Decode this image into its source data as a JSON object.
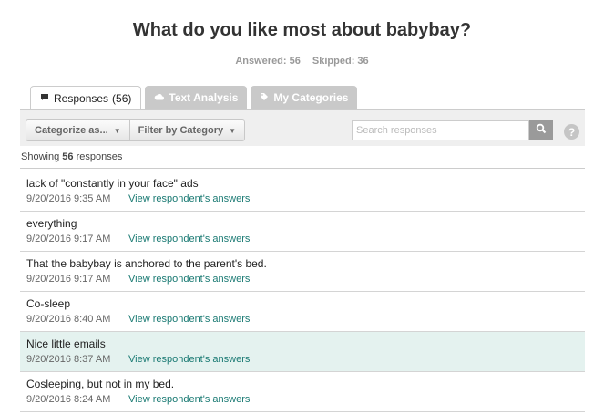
{
  "question": {
    "title": "What do you like most about babybay?",
    "answered": "Answered: 56",
    "skipped": "Skipped: 36"
  },
  "tabs": [
    {
      "label": "Responses",
      "count": "(56)",
      "icon": "speech-bubble-icon",
      "active": true
    },
    {
      "label": "Text Analysis",
      "icon": "cloud-icon",
      "active": false
    },
    {
      "label": "My Categories",
      "icon": "tag-icon",
      "active": false
    }
  ],
  "toolbar": {
    "categorize_label": "Categorize as...",
    "filter_label": "Filter by Category",
    "search_placeholder": "Search responses",
    "help_label": "?"
  },
  "summary": {
    "prefix": "Showing",
    "count": "56",
    "suffix": "responses"
  },
  "responses": [
    {
      "text": "lack of \"constantly in your face\" ads",
      "date": "9/20/2016 9:35 AM",
      "link": "View respondent's answers"
    },
    {
      "text": "everything",
      "date": "9/20/2016 9:17 AM",
      "link": "View respondent's answers"
    },
    {
      "text": "That the babybay is anchored to the parent's bed.",
      "date": "9/20/2016 9:17 AM",
      "link": "View respondent's answers"
    },
    {
      "text": "Co-sleep",
      "date": "9/20/2016 8:40 AM",
      "link": "View respondent's answers"
    },
    {
      "text": "Nice little emails",
      "date": "9/20/2016 8:37 AM",
      "link": "View respondent's answers",
      "highlighted": true
    },
    {
      "text": "Cosleeping, but not in my bed.",
      "date": "9/20/2016 8:24 AM",
      "link": "View respondent's answers"
    }
  ],
  "colors": {
    "link": "#1a7a73",
    "highlight_row": "#e4f2ef",
    "inactive_tab": "#c9c9c9"
  }
}
